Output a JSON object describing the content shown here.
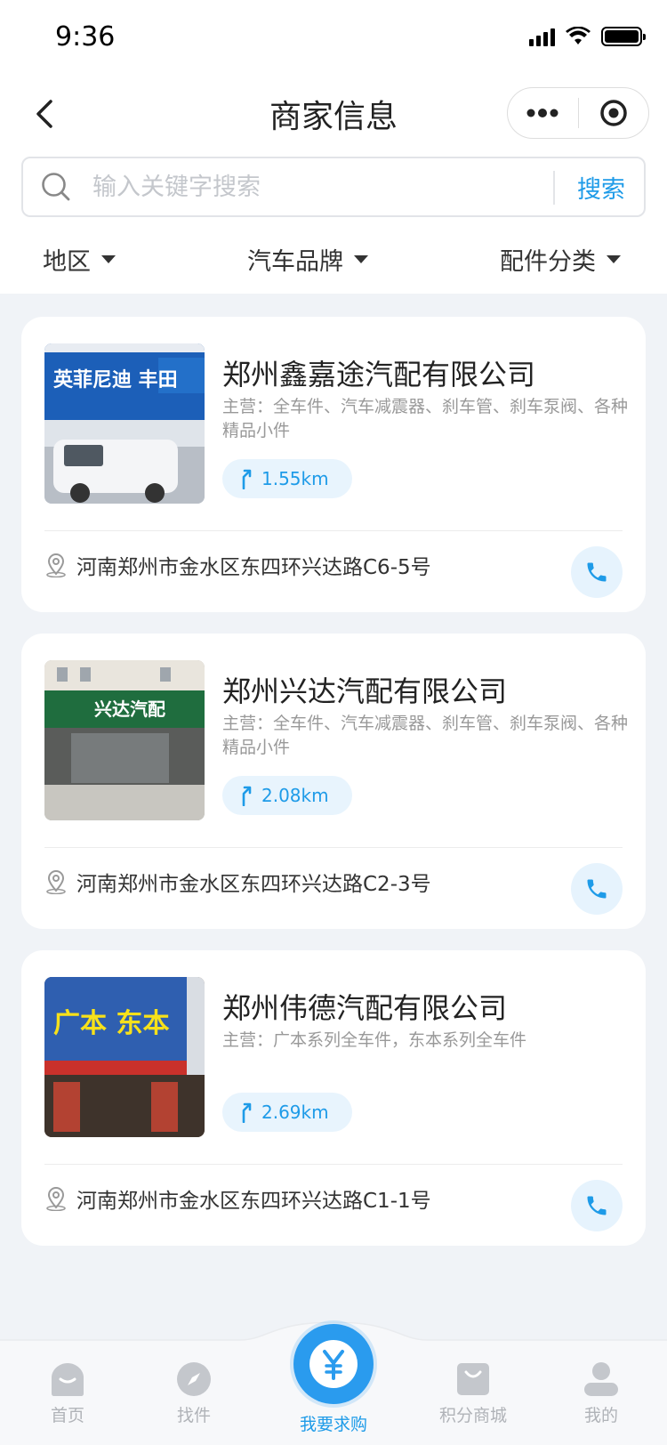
{
  "status_bar": {
    "time": "9:36"
  },
  "nav": {
    "title": "商家信息"
  },
  "search": {
    "placeholder": "输入关键字搜索",
    "button_label": "搜索"
  },
  "filters": [
    {
      "label": "地区"
    },
    {
      "label": "汽车品牌"
    },
    {
      "label": "配件分类"
    }
  ],
  "merchants": [
    {
      "name": "郑州鑫嘉途汽配有限公司",
      "business": "主营：全车件、汽车减震器、刹车管、刹车泵阀、各种精品小件",
      "distance": "1.55km",
      "address": "河南郑州市金水区东四环兴达路C6-5号",
      "sign_text": "英菲尼迪 丰田"
    },
    {
      "name": "郑州兴达汽配有限公司",
      "business": "主营：全车件、汽车减震器、刹车管、刹车泵阀、各种精品小件",
      "distance": "2.08km",
      "address": "河南郑州市金水区东四环兴达路C2-3号",
      "sign_text": "兴达汽配"
    },
    {
      "name": "郑州伟德汽配有限公司",
      "business": "主营：广本系列全车件，东本系列全车件",
      "distance": "2.69km",
      "address": "河南郑州市金水区东四环兴达路C1-1号",
      "sign_text": "广本 东本"
    }
  ],
  "tabbar": {
    "home": "首页",
    "find_parts": "找件",
    "purchase": "我要求购",
    "points_mall": "积分商城",
    "mine": "我的"
  },
  "colors": {
    "accent": "#1e9be8",
    "page_bg": "#f0f3f7",
    "tab_inactive": "#b0b3b8"
  }
}
